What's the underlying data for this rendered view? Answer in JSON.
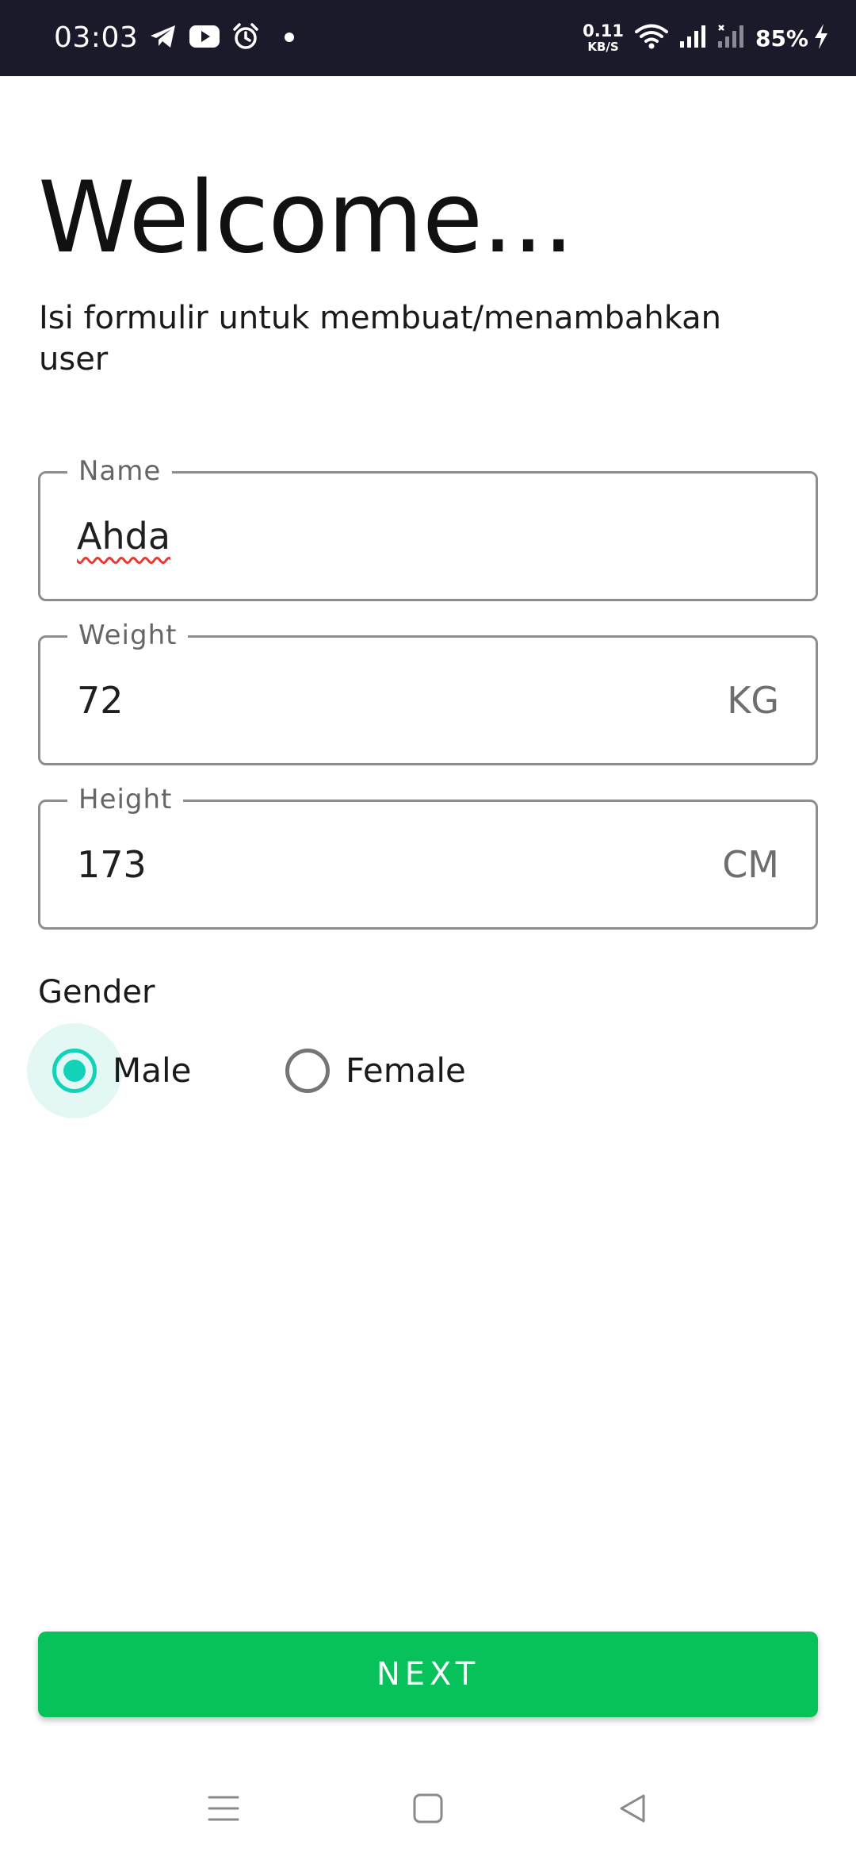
{
  "status_bar": {
    "time": "03:03",
    "net_speed_value": "0.11",
    "net_speed_unit": "KB/S",
    "battery": "85%",
    "icons": [
      "telegram-icon",
      "youtube-icon",
      "alarm-icon",
      "notification-dot-icon",
      "wifi-icon",
      "signal-icon",
      "signal-no-sim-icon",
      "charging-icon"
    ]
  },
  "header": {
    "title": "Welcome...",
    "subtitle": "Isi formulir untuk membuat/menambahkan user"
  },
  "form": {
    "name": {
      "label": "Name",
      "value": "Ahda"
    },
    "weight": {
      "label": "Weight",
      "value": "72",
      "suffix": "KG"
    },
    "height": {
      "label": "Height",
      "value": "173",
      "suffix": "CM"
    },
    "gender": {
      "label": "Gender",
      "options": [
        {
          "label": "Male",
          "selected": true
        },
        {
          "label": "Female",
          "selected": false
        }
      ]
    }
  },
  "actions": {
    "next_label": "NEXT"
  },
  "nav_bar": {
    "icons": [
      "menu-icon",
      "home-icon",
      "back-icon"
    ]
  },
  "colors": {
    "status_bar_bg": "#1b1a2b",
    "accent_radio": "#12d3b9",
    "button_green": "#07c15a",
    "field_border": "#8e8e8e"
  }
}
